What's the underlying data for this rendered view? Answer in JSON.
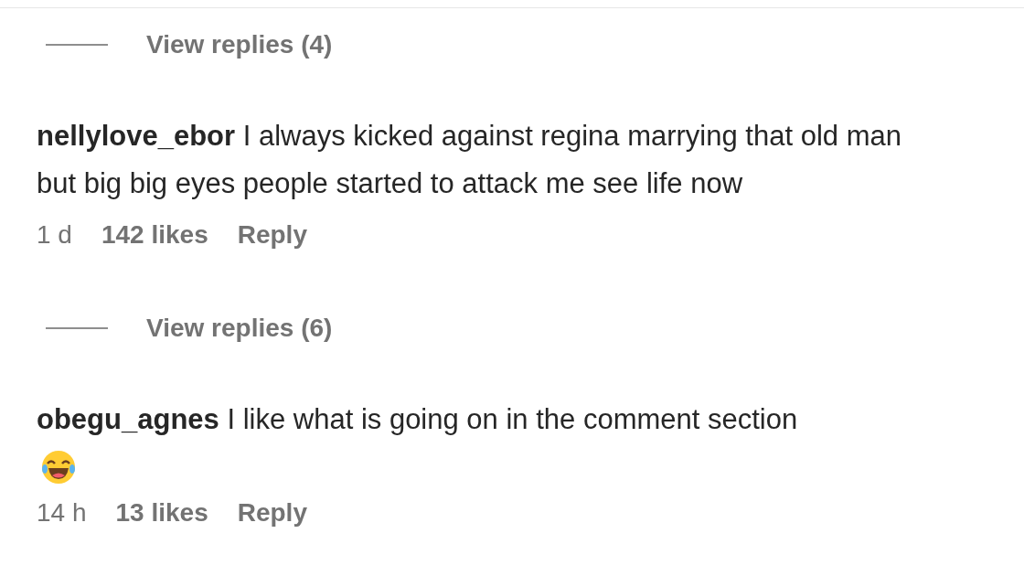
{
  "threads": [
    {
      "replies_link": "View replies (4)",
      "comment": {
        "username": "nellylove_ebor",
        "text": "I always kicked against regina marrying that old man but big big eyes people started to attack me see life now",
        "emoji": false,
        "time": "1 d",
        "likes": "142 likes",
        "reply": "Reply"
      }
    },
    {
      "replies_link": "View replies (6)",
      "comment": {
        "username": "obegu_agnes",
        "text": "I like what is going on in the comment section",
        "emoji": true,
        "time": "14 h",
        "likes": "13 likes",
        "reply": "Reply"
      }
    }
  ]
}
